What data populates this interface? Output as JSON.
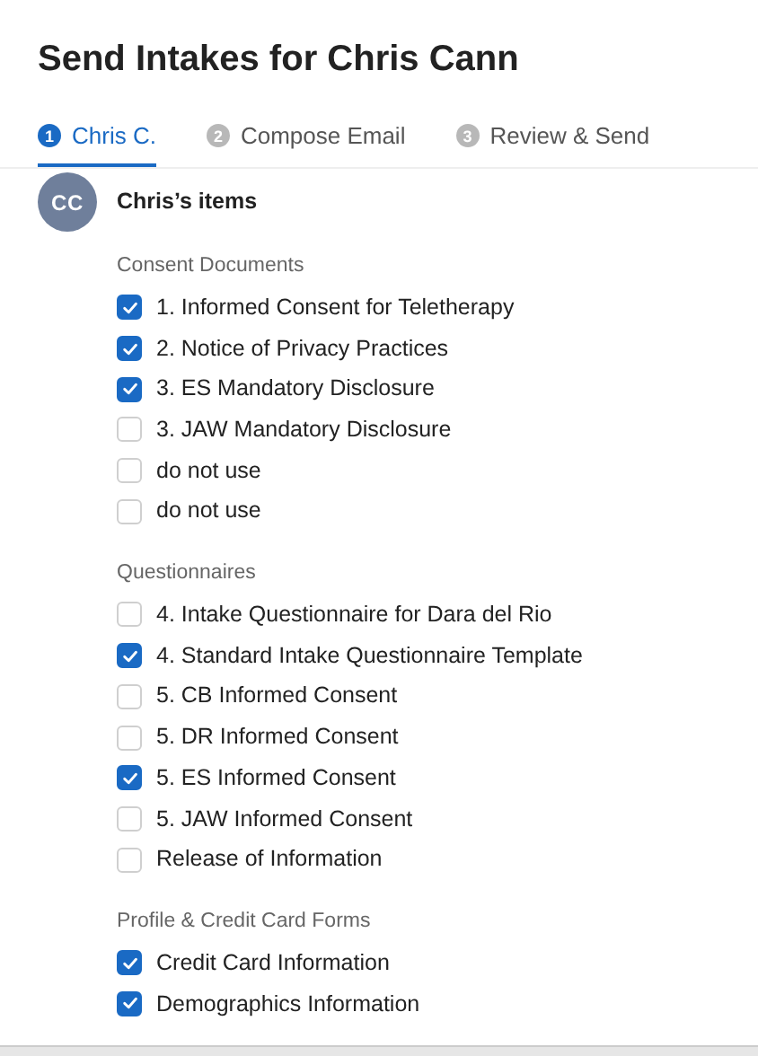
{
  "title": "Send Intakes for Chris Cann",
  "steps": [
    {
      "number": "1",
      "label": "Chris C.",
      "selected": true
    },
    {
      "number": "2",
      "label": "Compose Email",
      "selected": false
    },
    {
      "number": "3",
      "label": "Review & Send",
      "selected": false
    }
  ],
  "client": {
    "initials": "CC",
    "heading": "Chris’s items"
  },
  "sections": [
    {
      "title": "Consent Documents",
      "items": [
        {
          "label": "1. Informed Consent for Teletherapy",
          "checked": true
        },
        {
          "label": "2. Notice of Privacy Practices",
          "checked": true
        },
        {
          "label": "3. ES Mandatory Disclosure",
          "checked": true
        },
        {
          "label": "3. JAW Mandatory Disclosure",
          "checked": false
        },
        {
          "label": "do not use",
          "checked": false
        },
        {
          "label": "do not use",
          "checked": false
        }
      ]
    },
    {
      "title": "Questionnaires",
      "items": [
        {
          "label": "4. Intake Questionnaire for Dara del Rio",
          "checked": false
        },
        {
          "label": "4. Standard Intake Questionnaire Template",
          "checked": true
        },
        {
          "label": "5. CB Informed Consent",
          "checked": false
        },
        {
          "label": "5. DR Informed Consent",
          "checked": false
        },
        {
          "label": "5. ES Informed Consent",
          "checked": true
        },
        {
          "label": "5. JAW Informed Consent",
          "checked": false
        },
        {
          "label": "Release of Information",
          "checked": false
        }
      ]
    },
    {
      "title": "Profile & Credit Card Forms",
      "items": [
        {
          "label": "Credit Card Information",
          "checked": true
        },
        {
          "label": "Demographics Information",
          "checked": true
        }
      ]
    }
  ]
}
